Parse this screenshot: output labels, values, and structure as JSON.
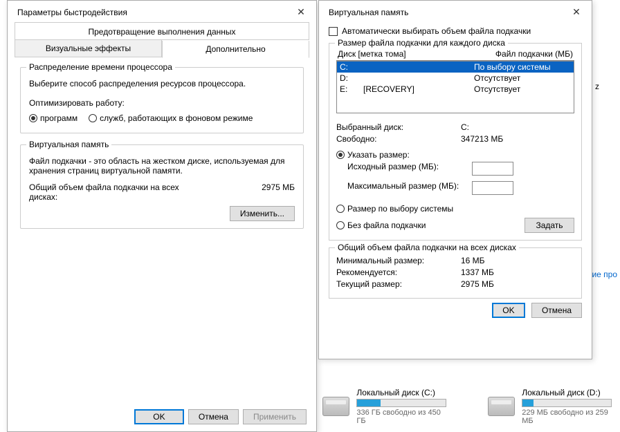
{
  "perf": {
    "title": "Параметры быстродействия",
    "tab_dep": "Предотвращение выполнения данных",
    "tab_visual": "Визуальные эффекты",
    "tab_adv": "Дополнительно",
    "sched": {
      "legend": "Распределение времени процессора",
      "desc": "Выберите способ распределения ресурсов процессора.",
      "optimize": "Оптимизировать работу:",
      "programs": "программ",
      "services": "служб, работающих в фоновом режиме"
    },
    "vm": {
      "legend": "Виртуальная память",
      "desc": "Файл подкачки - это область на жестком диске, используемая для хранения страниц виртуальной памяти.",
      "total_label": "Общий объем файла подкачки на всех дисках:",
      "total_value": "2975 МБ",
      "change": "Изменить..."
    },
    "ok": "OK",
    "cancel": "Отмена",
    "apply": "Применить"
  },
  "vmem": {
    "title": "Виртуальная память",
    "auto": "Автоматически выбирать объем файла подкачки",
    "group1": "Размер файла подкачки для каждого диска",
    "col_disk": "Диск [метка тома]",
    "col_file": "Файл подкачки (МБ)",
    "rows": [
      {
        "drive": "C:",
        "label": "",
        "file": "По выбору системы",
        "sel": true
      },
      {
        "drive": "D:",
        "label": "",
        "file": "Отсутствует",
        "sel": false
      },
      {
        "drive": "E:",
        "label": "[RECOVERY]",
        "file": "Отсутствует",
        "sel": false
      }
    ],
    "sel_drive_l": "Выбранный диск:",
    "sel_drive_v": "C:",
    "free_l": "Свободно:",
    "free_v": "347213 МБ",
    "custom": "Указать размер:",
    "init_l": "Исходный размер (МБ):",
    "max_l": "Максимальный размер (МБ):",
    "system": "Размер по выбору системы",
    "none": "Без файла подкачки",
    "set": "Задать",
    "group2": "Общий объем файла подкачки на всех дисках",
    "min_l": "Минимальный размер:",
    "min_v": "16 МБ",
    "rec_l": "Рекомендуется:",
    "rec_v": "1337 МБ",
    "cur_l": "Текущий размер:",
    "cur_v": "2975 МБ",
    "ok": "OK",
    "cancel": "Отмена"
  },
  "bg": {
    "link": "зование про",
    "z": "z",
    "disks": [
      {
        "name": "Локальный диск (C:)",
        "sub": "336 ГБ свободно из 450 ГБ",
        "fill": 26
      },
      {
        "name": "Локальный диск (D:)",
        "sub": "229 МБ свободно из 259 МБ",
        "fill": 12
      }
    ]
  }
}
